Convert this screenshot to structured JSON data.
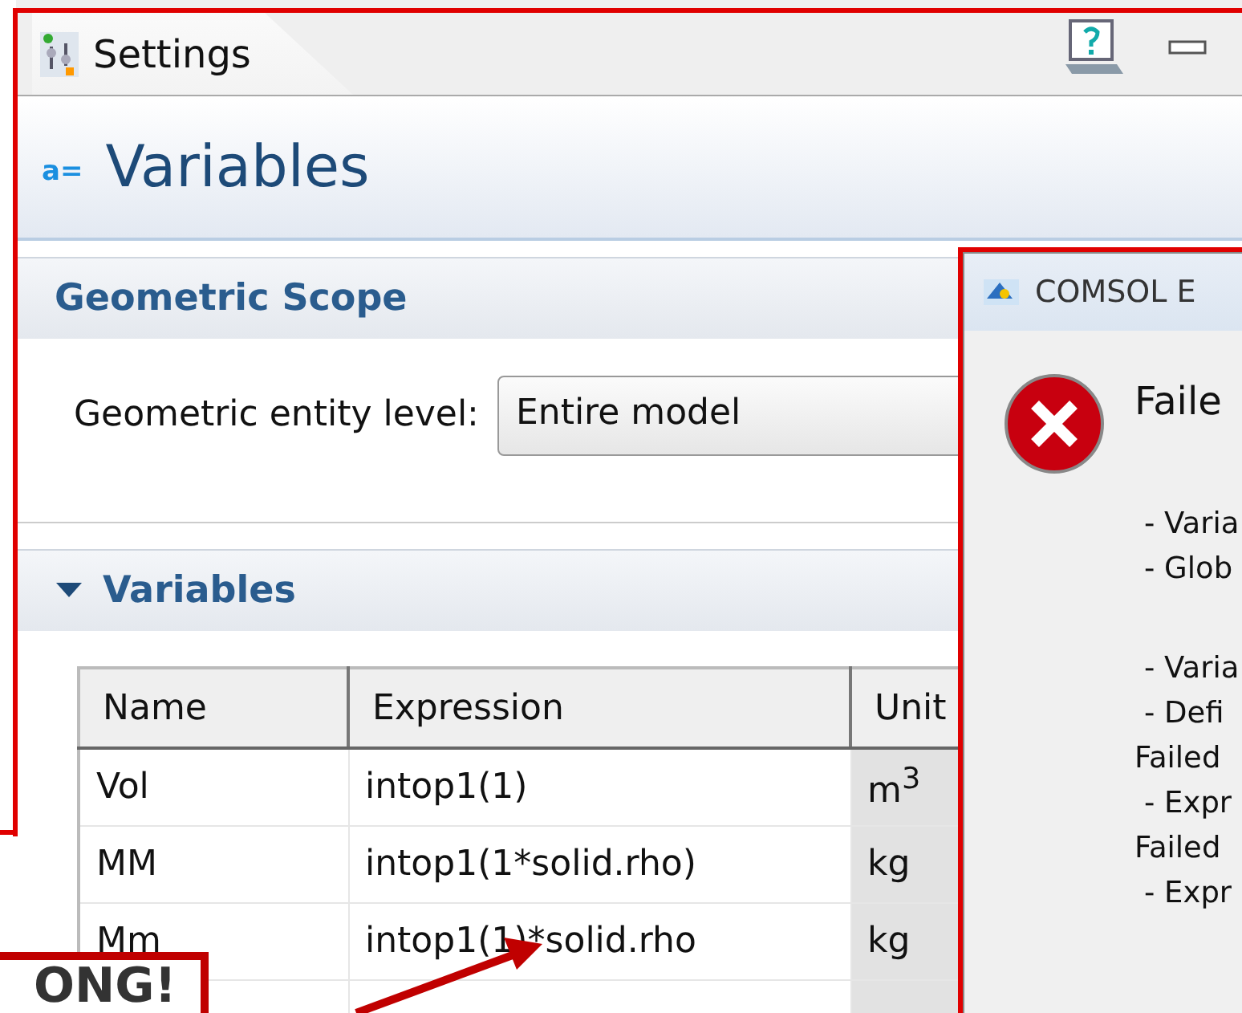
{
  "tab": {
    "label": "Settings"
  },
  "header": {
    "icon_text": "a=",
    "title": "Variables"
  },
  "geometric_scope": {
    "title": "Geometric Scope",
    "entity_level_label": "Geometric entity level:",
    "entity_level_value": "Entire model"
  },
  "variables_section": {
    "title": "Variables",
    "expanded": true,
    "table": {
      "columns": [
        "Name",
        "Expression",
        "Unit"
      ],
      "rows": [
        {
          "name": "Vol",
          "expression": "intop1(1)",
          "unit": "m$^{3}$"
        },
        {
          "name": "MM",
          "expression": "intop1(1*solid.rho)",
          "unit": "kg"
        },
        {
          "name": "Mm",
          "expression": "intop1(1)*solid.rho",
          "unit": "kg"
        }
      ]
    }
  },
  "error_dialog": {
    "title": "COMSOL E",
    "message": "Faile",
    "groups": [
      {
        "lines": [
          {
            "kind": "item",
            "text": "- Varia"
          },
          {
            "kind": "item",
            "text": "- Glob"
          }
        ]
      },
      {
        "lines": [
          {
            "kind": "item",
            "text": "- Varia"
          },
          {
            "kind": "item",
            "text": "- Defi"
          },
          {
            "kind": "heading",
            "text": "Failed"
          },
          {
            "kind": "item",
            "text": "- Expr"
          },
          {
            "kind": "heading",
            "text": "Failed"
          },
          {
            "kind": "item",
            "text": "- Expr"
          }
        ]
      }
    ]
  },
  "annotation": {
    "callout_text": "ONG!"
  }
}
